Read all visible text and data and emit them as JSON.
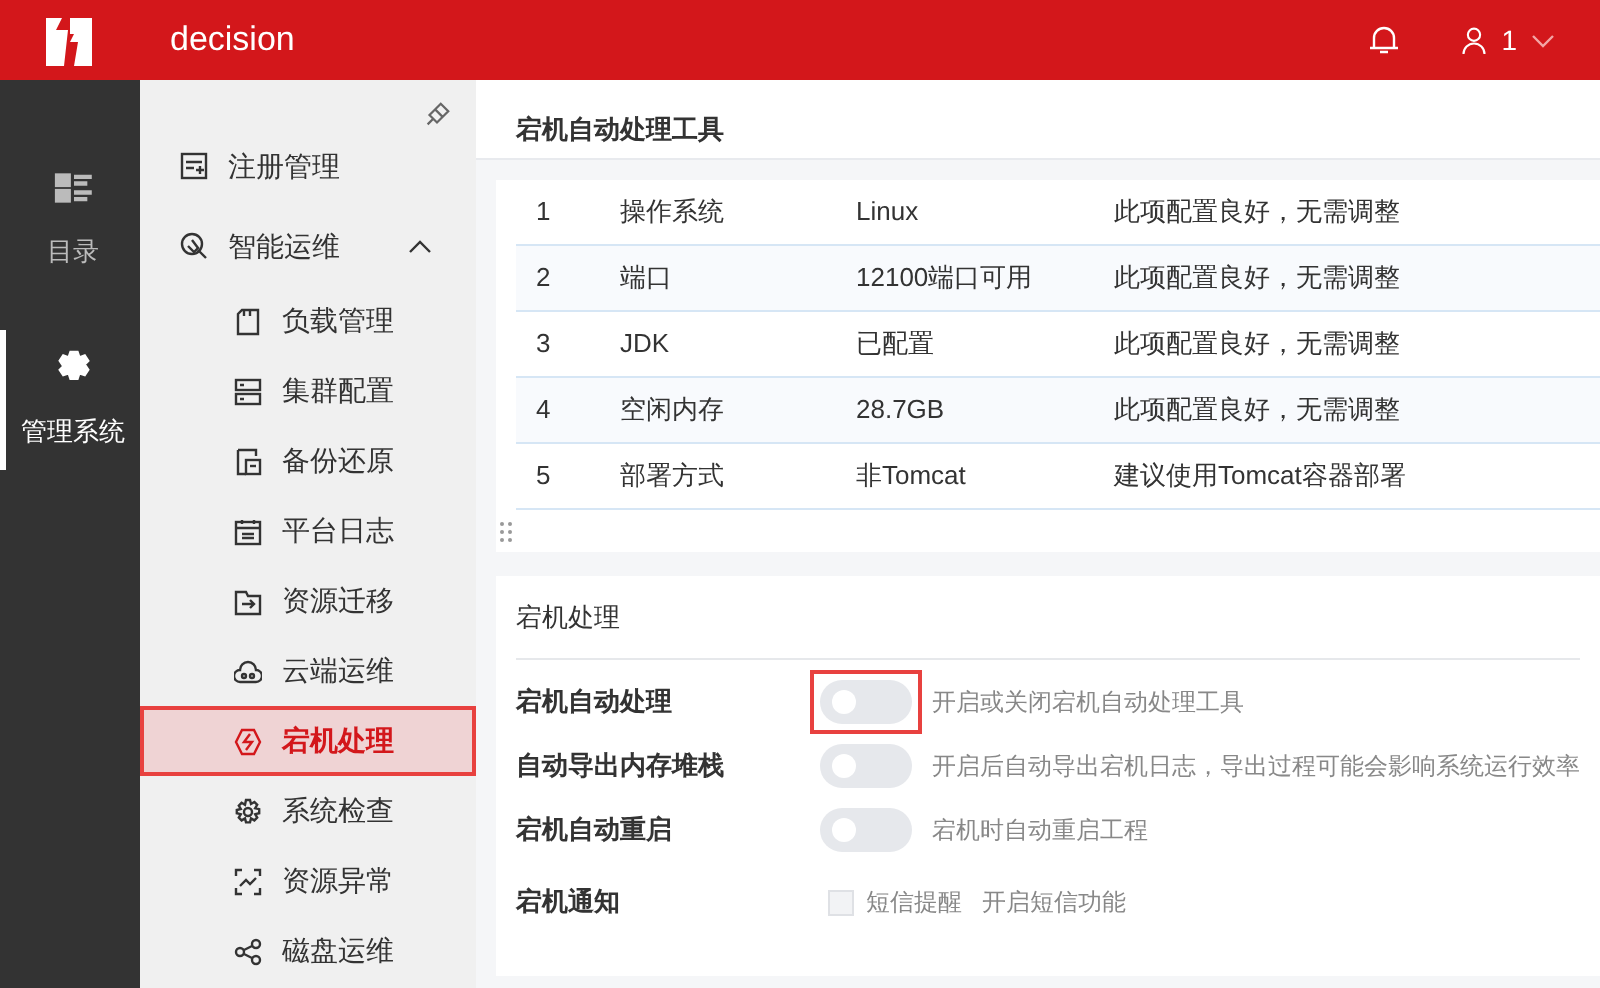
{
  "header": {
    "title": "decision",
    "user": "1"
  },
  "rail": [
    {
      "label": "目录",
      "kind": "catalog",
      "selected": false
    },
    {
      "label": "管理系统",
      "kind": "gear",
      "selected": true
    }
  ],
  "sidebar": {
    "items": [
      {
        "label": "注册管理",
        "kind": "register",
        "selected": false,
        "highlighted": false
      },
      {
        "label": "智能运维",
        "kind": "ops",
        "expanded": true,
        "selected": false,
        "highlighted": false,
        "children": [
          {
            "label": "负载管理",
            "kind": "load",
            "selected": false,
            "highlighted": false
          },
          {
            "label": "集群配置",
            "kind": "cluster",
            "selected": false,
            "highlighted": false
          },
          {
            "label": "备份还原",
            "kind": "backup",
            "selected": false,
            "highlighted": false
          },
          {
            "label": "平台日志",
            "kind": "log",
            "selected": false,
            "highlighted": false
          },
          {
            "label": "资源迁移",
            "kind": "migrate",
            "selected": false,
            "highlighted": false
          },
          {
            "label": "云端运维",
            "kind": "cloud",
            "selected": false,
            "highlighted": false
          },
          {
            "label": "宕机处理",
            "kind": "crash",
            "selected": true,
            "highlighted": true
          },
          {
            "label": "系统检查",
            "kind": "gear",
            "selected": false,
            "highlighted": false
          },
          {
            "label": "资源异常",
            "kind": "scan",
            "selected": false,
            "highlighted": false
          },
          {
            "label": "磁盘运维",
            "kind": "share",
            "selected": false,
            "highlighted": false
          }
        ]
      }
    ]
  },
  "page_title": "宕机自动处理工具",
  "table": {
    "rows": [
      [
        "1",
        "操作系统",
        "Linux",
        "此项配置良好，无需调整"
      ],
      [
        "2",
        "端口",
        "12100端口可用",
        "此项配置良好，无需调整"
      ],
      [
        "3",
        "JDK",
        "已配置",
        "此项配置良好，无需调整"
      ],
      [
        "4",
        "空闲内存",
        "28.7GB",
        "此项配置良好，无需调整"
      ],
      [
        "5",
        "部署方式",
        "非Tomcat",
        "建议使用Tomcat容器部署"
      ]
    ]
  },
  "settings": {
    "title": "宕机处理",
    "rows": [
      {
        "label": "宕机自动处理",
        "kind": "switch",
        "on": false,
        "framed": true,
        "description": "开启或关闭宕机自动处理工具"
      },
      {
        "label": "自动导出内存堆栈",
        "kind": "switch",
        "on": false,
        "framed": false,
        "description": "开启后自动导出宕机日志，导出过程可能会影响系统运行效率"
      },
      {
        "label": "宕机自动重启",
        "kind": "switch",
        "on": false,
        "framed": false,
        "description": "宕机时自动重启工程"
      },
      {
        "label": "宕机通知",
        "kind": "checkbox",
        "checked": false,
        "option": "短信提醒",
        "description": "开启短信功能"
      }
    ]
  }
}
